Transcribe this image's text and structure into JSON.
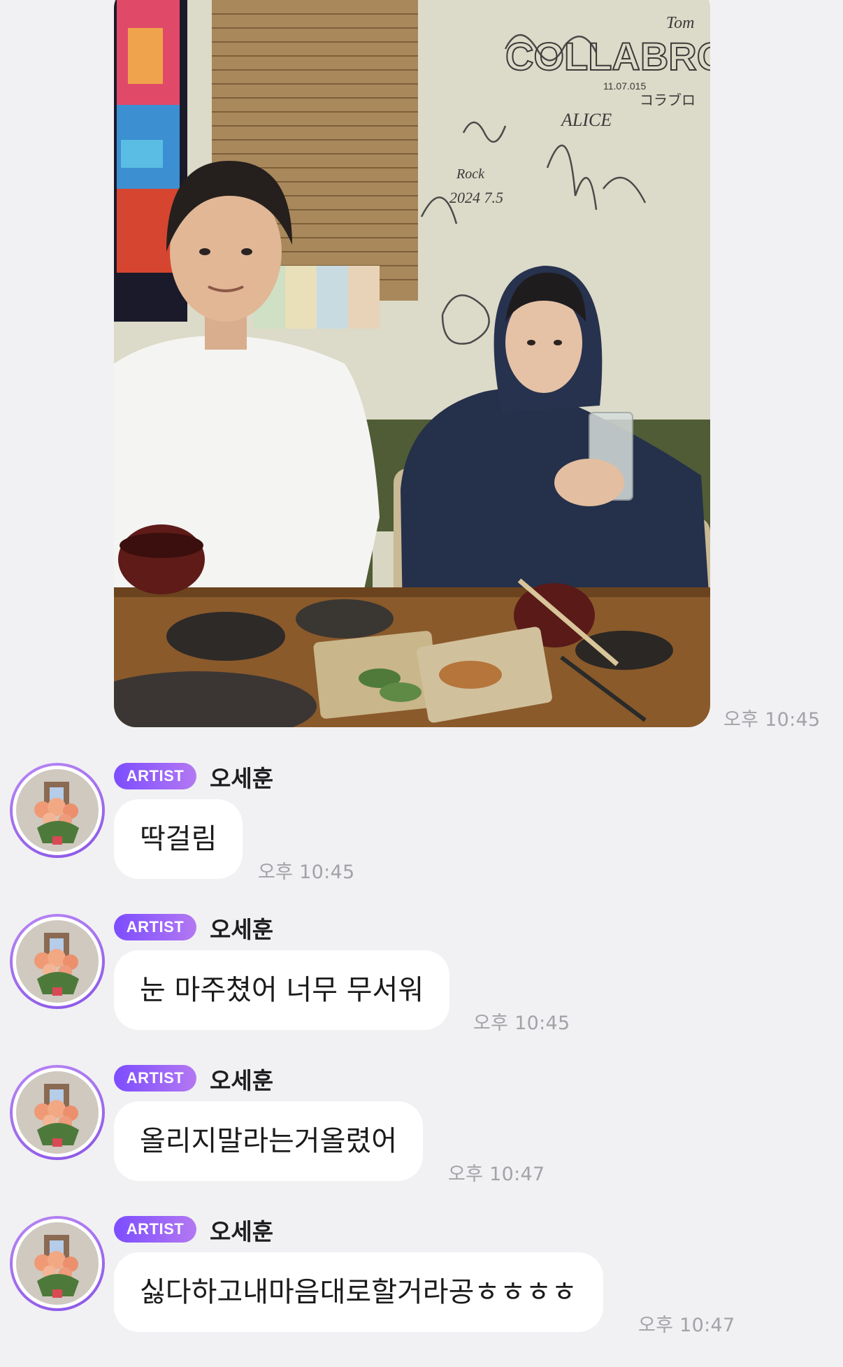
{
  "photo_message": {
    "time": "오후 10:45",
    "wall_text": {
      "brand": "COLLABRO",
      "date": "11.07.015",
      "katakana": "コラブロ",
      "signature_tom": "Tom",
      "signature_alice": "ALICE",
      "signature_year": "2024 7.5",
      "signature_rock": "Rock"
    }
  },
  "artist_badge": "ARTIST",
  "messages": [
    {
      "sender": "오세훈",
      "text": "딱걸림",
      "time": "오후 10:45"
    },
    {
      "sender": "오세훈",
      "text": "눈 마주쳤어 너무 무서워",
      "time": "오후 10:45"
    },
    {
      "sender": "오세훈",
      "text": "올리지말라는거올렸어",
      "time": "오후 10:47"
    },
    {
      "sender": "오세훈",
      "text": "싫다하고내마음대로할거라공ㅎㅎㅎㅎ",
      "time": "오후 10:47"
    }
  ],
  "colors": {
    "background": "#f1f1f3",
    "bubble": "#ffffff",
    "badge_start": "#7c4dff",
    "badge_end": "#b378f2",
    "timestamp": "#a2a2a8"
  }
}
